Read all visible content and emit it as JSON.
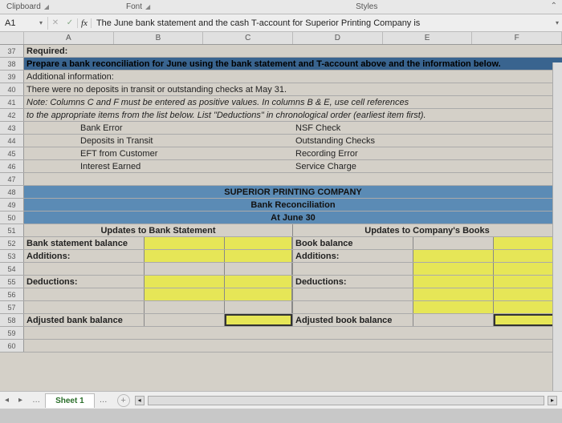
{
  "ribbon": {
    "clipboard": "Clipboard",
    "font": "Font",
    "styles": "Styles"
  },
  "namebox": "A1",
  "formula": "The June bank statement and the cash T-account for Superior Printing Company is",
  "cols": [
    "A",
    "B",
    "C",
    "D",
    "E",
    "F"
  ],
  "r37": "Required:",
  "r38": "Prepare a bank reconciliation for June using the bank statement and T-account above and the information below.",
  "r39": "Additional information:",
  "r40": "There were no deposits in transit or outstanding checks at May 31.",
  "r41": "Note: Columns C and F must be entered as positive values.  In columns B & E, use cell references",
  "r42": "to the appropriate items from the list below.  List \"Deductions\" in chronological order (earliest item first).",
  "list": {
    "l1a": "Bank Error",
    "l1b": "NSF Check",
    "l2a": "Deposits in Transit",
    "l2b": "Outstanding Checks",
    "l3a": "EFT from Customer",
    "l3b": "Recording Error",
    "l4a": "Interest Earned",
    "l4b": "Service Charge"
  },
  "hdr": {
    "company": "SUPERIOR PRINTING COMPANY",
    "title": "Bank Reconciliation",
    "date": "At June 30"
  },
  "colhdr": {
    "left": "Updates to Bank Statement",
    "right": "Updates to Company's Books"
  },
  "labels": {
    "bankStmt": "Bank statement balance",
    "book": "Book balance",
    "addL": "Additions:",
    "addR": "Additions:",
    "dedL": "Deductions:",
    "dedR": "Deductions:",
    "adjL": "Adjusted bank balance",
    "adjR": "Adjusted book balance"
  },
  "sheet": "Sheet 1"
}
